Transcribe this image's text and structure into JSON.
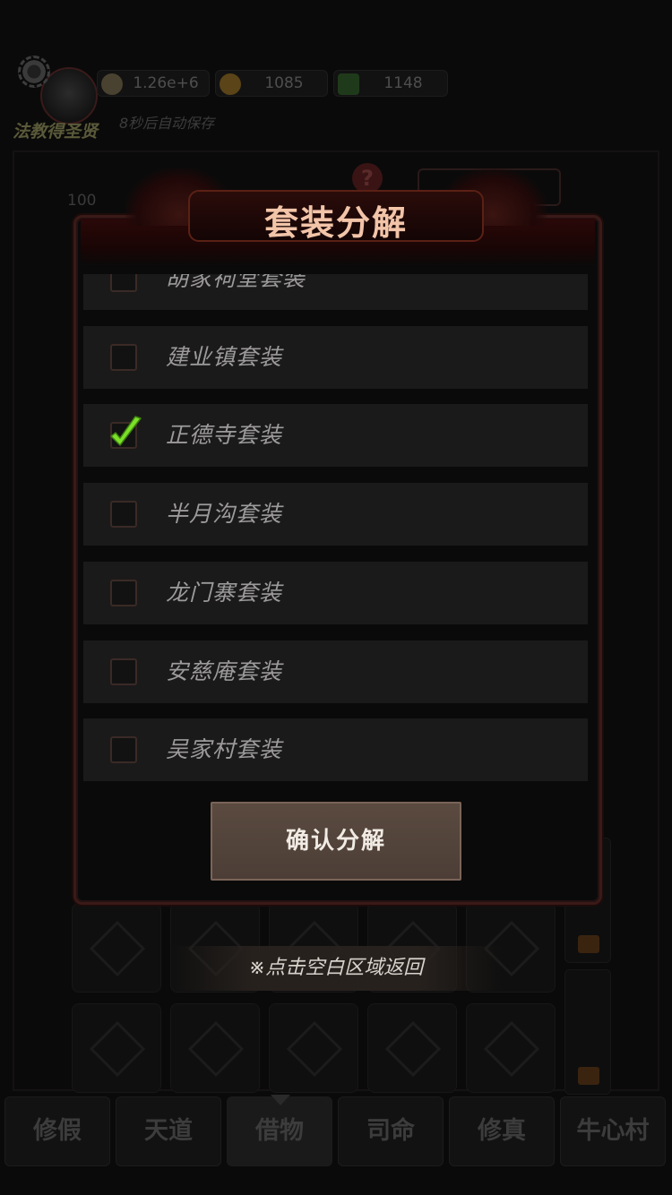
{
  "hud": {
    "player_name": "法教得圣贤",
    "autosave": "8秒后自动保存",
    "resources": [
      {
        "icon": "copper-coin-icon",
        "value": "1.26e+6"
      },
      {
        "icon": "gold-ingot-icon",
        "value": "1085"
      },
      {
        "icon": "jade-icon",
        "value": "1148"
      }
    ]
  },
  "background": {
    "number": "100",
    "help_glyph": "?"
  },
  "modal": {
    "title": "套装分解",
    "items": [
      {
        "label": "胡家祠堂套装",
        "checked": false
      },
      {
        "label": "建业镇套装",
        "checked": false
      },
      {
        "label": "正德寺套装",
        "checked": true
      },
      {
        "label": "半月沟套装",
        "checked": false
      },
      {
        "label": "龙门寨套装",
        "checked": false
      },
      {
        "label": "安慈庵套装",
        "checked": false
      },
      {
        "label": "吴家村套装",
        "checked": false
      }
    ],
    "confirm_label": "确认分解",
    "check_color": "#7be028"
  },
  "return_hint": "※点击空白区域返回",
  "tabs": [
    {
      "label": "修假"
    },
    {
      "label": "天道"
    },
    {
      "label": "借物",
      "active": true
    },
    {
      "label": "司命"
    },
    {
      "label": "修真"
    },
    {
      "label": "牛心村"
    }
  ]
}
